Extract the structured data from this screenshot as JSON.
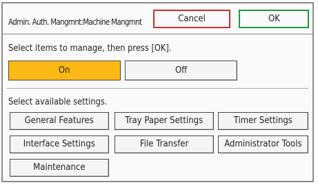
{
  "header": {
    "title": "Admin. Auth. Mangmnt:Machine Mangmnt",
    "cancel_label": "Cancel",
    "ok_label": "OK"
  },
  "manage": {
    "instruction": "Select items to manage, then press [OK].",
    "on_label": "On",
    "off_label": "Off",
    "selected": "On"
  },
  "settings": {
    "instruction": "Select available settings.",
    "items": [
      "General Features",
      "Tray Paper Settings",
      "Timer Settings",
      "Interface Settings",
      "File Transfer",
      "Administrator Tools",
      "Maintenance"
    ]
  },
  "colors": {
    "selected_fill": "#fcb814",
    "cancel_border": "#d22a2a",
    "ok_border": "#1c9a3a"
  }
}
